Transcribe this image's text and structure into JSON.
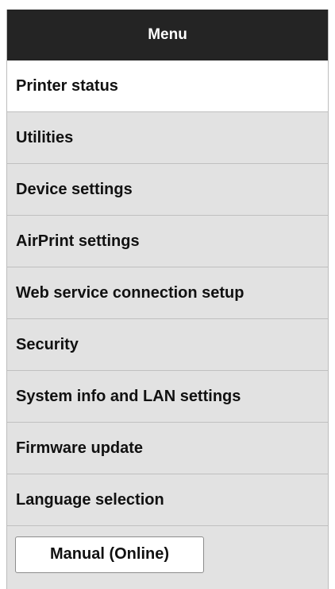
{
  "menu": {
    "title": "Menu",
    "items": [
      {
        "label": "Printer status",
        "active": true
      },
      {
        "label": "Utilities",
        "active": false
      },
      {
        "label": "Device settings",
        "active": false
      },
      {
        "label": "AirPrint settings",
        "active": false
      },
      {
        "label": "Web service connection setup",
        "active": false
      },
      {
        "label": "Security",
        "active": false
      },
      {
        "label": "System info and LAN settings",
        "active": false
      },
      {
        "label": "Firmware update",
        "active": false
      },
      {
        "label": "Language selection",
        "active": false
      }
    ],
    "manual_button_label": "Manual (Online)"
  },
  "colors": {
    "header_bg": "#242424",
    "item_bg": "#e2e2e2",
    "active_item_bg": "#ffffff"
  }
}
